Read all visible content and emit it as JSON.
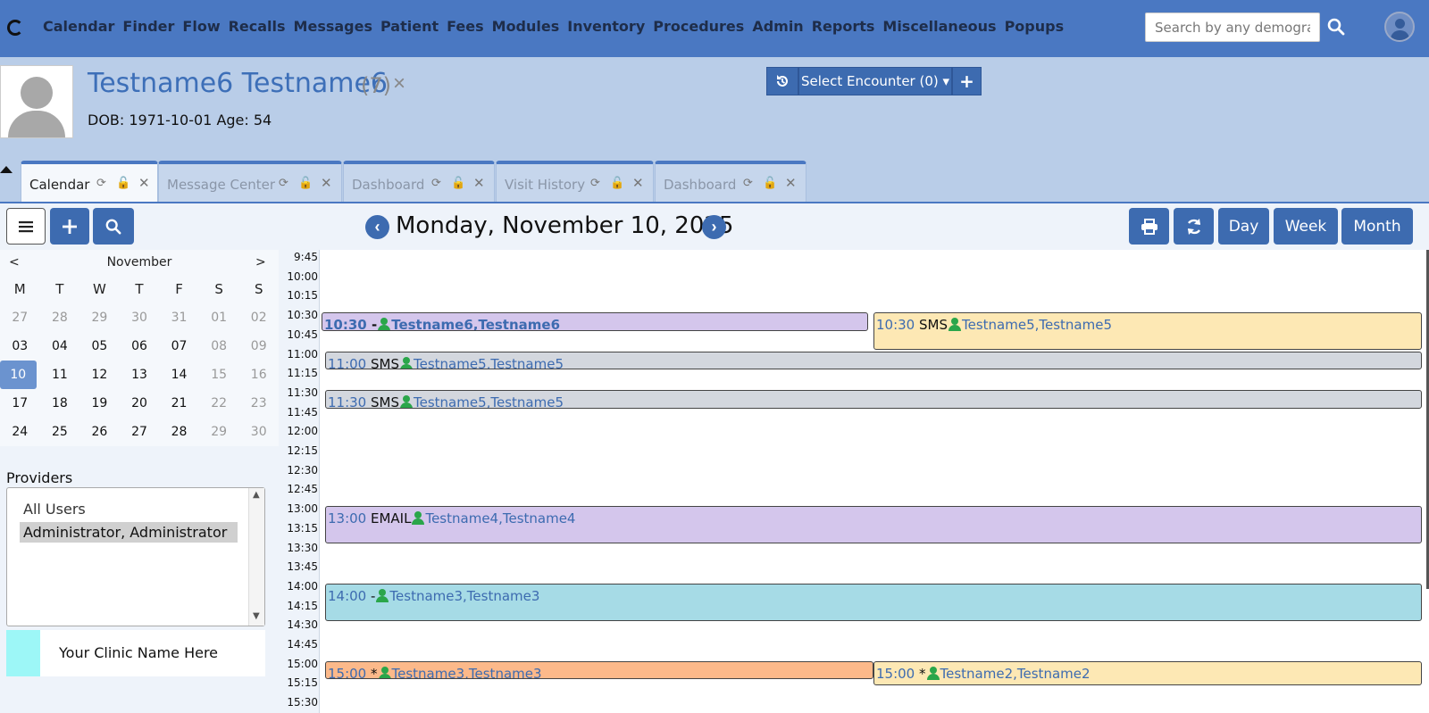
{
  "nav": {
    "items": [
      "Calendar",
      "Finder",
      "Flow",
      "Recalls",
      "Messages",
      "Patient",
      "Fees",
      "Modules",
      "Inventory",
      "Procedures",
      "Admin",
      "Reports",
      "Miscellaneous",
      "Popups"
    ],
    "search_placeholder": "Search by any demographics"
  },
  "patient": {
    "name": "Testname6 Testname6",
    "pid": "(7)",
    "close": "×",
    "dob_line": "DOB: 1971-10-01 Age: 54"
  },
  "encounter": {
    "select_label": "Select Encounter  (0) ▾",
    "add": "+"
  },
  "tabs": [
    {
      "label": "Calendar"
    },
    {
      "label": "Message Center"
    },
    {
      "label": "Dashboard"
    },
    {
      "label": "Visit History"
    },
    {
      "label": "Dashboard"
    }
  ],
  "toolbar": {
    "date_title": "Monday, November 10, 2025",
    "day": "Day",
    "week": "Week",
    "month": "Month"
  },
  "mini_calendar": {
    "prev": "<",
    "next": ">",
    "month": "November",
    "dow": [
      "M",
      "T",
      "W",
      "T",
      "F",
      "S",
      "S"
    ],
    "weeks": [
      [
        "27",
        "28",
        "29",
        "30",
        "31",
        "01",
        "02"
      ],
      [
        "03",
        "04",
        "05",
        "06",
        "07",
        "08",
        "09"
      ],
      [
        "10",
        "11",
        "12",
        "13",
        "14",
        "15",
        "16"
      ],
      [
        "17",
        "18",
        "19",
        "20",
        "21",
        "22",
        "23"
      ],
      [
        "24",
        "25",
        "26",
        "27",
        "28",
        "29",
        "30"
      ]
    ],
    "selected": "10"
  },
  "providers": {
    "label": "Providers",
    "items": [
      "All Users",
      "Administrator, Administrator"
    ],
    "selected_index": 1
  },
  "facility": {
    "name": "Your Clinic Name Here",
    "color": "#9df7f7"
  },
  "schedule": {
    "times": [
      "9:45",
      "10:00",
      "10:15",
      "10:30",
      "10:45",
      "11:00",
      "11:15",
      "11:30",
      "11:45",
      "12:00",
      "12:15",
      "12:30",
      "12:45",
      "13:00",
      "13:15",
      "13:30",
      "13:45",
      "14:00",
      "14:15",
      "14:30",
      "14:45",
      "15:00",
      "15:15",
      "15:30"
    ],
    "events": [
      {
        "time": "10:30",
        "category": " -",
        "patient": "Testname6,Testname6",
        "color": "#d4c6ec",
        "bold": true
      },
      {
        "time": "10:30",
        "category": " SMS",
        "patient": "Testname5,Testname5",
        "color": "#fde8b4",
        "bold": false
      },
      {
        "time": "11:00",
        "category": " SMS",
        "patient": "Testname5,Testname5",
        "color": "#d3d7de",
        "bold": false
      },
      {
        "time": "11:30",
        "category": " SMS",
        "patient": "Testname5,Testname5",
        "color": "#d3d7de",
        "bold": false
      },
      {
        "time": "13:00",
        "category": " EMAIL",
        "patient": "Testname4,Testname4",
        "color": "#d4c6ec",
        "bold": false
      },
      {
        "time": "14:00",
        "category": " -",
        "patient": "Testname3,Testname3",
        "color": "#a6dbe6",
        "bold": false
      },
      {
        "time": "15:00",
        "category": " *",
        "patient": "Testname3,Testname3",
        "color": "#fcb98a",
        "bold": false
      },
      {
        "time": "15:00",
        "category": " *",
        "patient": "Testname2,Testname2",
        "color": "#fde8b4",
        "bold": false
      }
    ]
  }
}
